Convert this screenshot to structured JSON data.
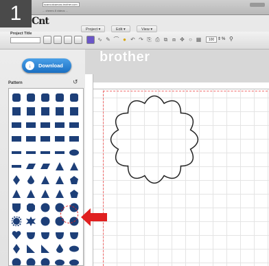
{
  "step_number": "1",
  "browser": {
    "url": "scancutcanvas.brother.com",
    "subtext": "... cheers 8 videos ..."
  },
  "app": {
    "logo_text": "Cnt"
  },
  "menus": [
    "Project",
    "Edit",
    "View"
  ],
  "toolbar": {
    "project_title_label": "Project Title",
    "project_title_value": "",
    "zoom_value": "100",
    "zoom_unit": "%"
  },
  "left_panel": {
    "download_label": "Download",
    "pattern_label": "Pattern"
  },
  "canvas": {
    "brand_text": "brother"
  },
  "icons": {
    "download": "download-icon",
    "undo": "undo-icon",
    "zoom": "magnifier-icon"
  },
  "colors": {
    "accent_blue": "#1a6fc2",
    "shape_navy": "#1d3f78",
    "highlight_red": "#e02020",
    "cut_line": "#e66666"
  }
}
